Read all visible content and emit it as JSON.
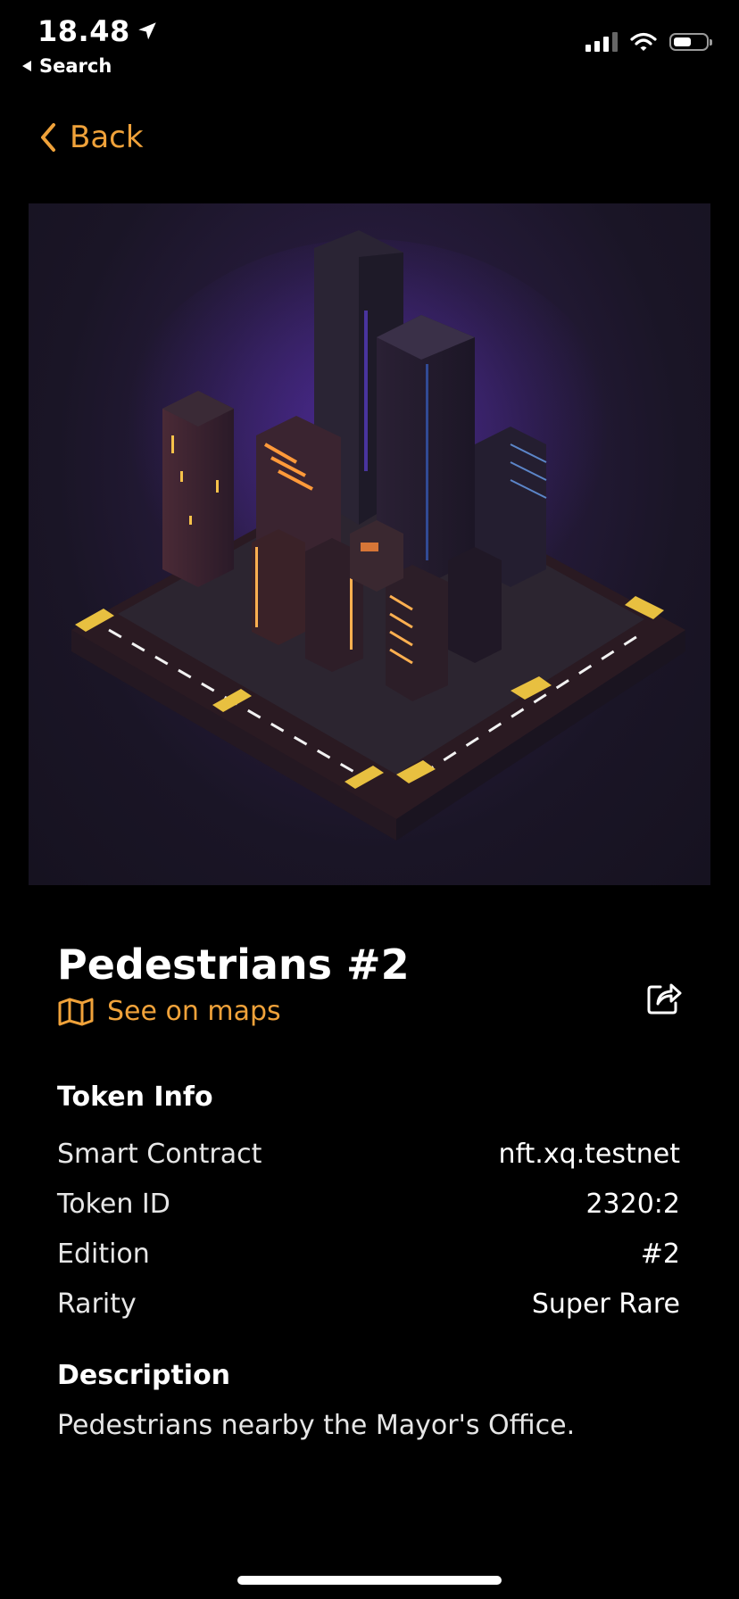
{
  "status_bar": {
    "time": "18.48",
    "back_app_label": "Search"
  },
  "nav": {
    "back_label": "Back"
  },
  "token": {
    "title": "Pedestrians #2",
    "maps_link": "See on maps",
    "info_heading": "Token Info",
    "rows": [
      {
        "label": "Smart Contract",
        "value": "nft.xq.testnet"
      },
      {
        "label": "Token ID",
        "value": "2320:2"
      },
      {
        "label": "Edition",
        "value": "#2"
      },
      {
        "label": "Rarity",
        "value": "Super Rare"
      }
    ],
    "description_heading": "Description",
    "description": "Pedestrians nearby the Mayor's Office."
  },
  "colors": {
    "accent": "#f0a23a",
    "background": "#000000"
  },
  "icons": [
    "location-arrow-icon",
    "back-triangle-icon",
    "signal-icon",
    "wifi-icon",
    "battery-icon",
    "chevron-left-icon",
    "map-icon",
    "share-icon"
  ]
}
